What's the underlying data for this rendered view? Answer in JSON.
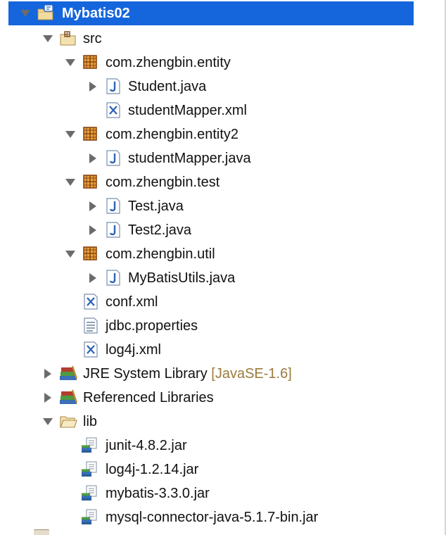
{
  "project_tree": {
    "project": {
      "label": "Mybatis02"
    },
    "src_folder": {
      "label": "src"
    },
    "pkg_entity": {
      "label": "com.zhengbin.entity"
    },
    "file_student_java": {
      "label": "Student.java"
    },
    "file_student_mapper_xml": {
      "label": "studentMapper.xml"
    },
    "pkg_entity2": {
      "label": "com.zhengbin.entity2"
    },
    "file_student_mapper_java": {
      "label": "studentMapper.java"
    },
    "pkg_test": {
      "label": "com.zhengbin.test"
    },
    "file_test_java": {
      "label": "Test.java"
    },
    "file_test2_java": {
      "label": "Test2.java"
    },
    "pkg_util": {
      "label": "com.zhengbin.util"
    },
    "file_mybatis_utils_java": {
      "label": "MyBatisUtils.java"
    },
    "file_conf_xml": {
      "label": "conf.xml"
    },
    "file_jdbc_properties": {
      "label": "jdbc.properties"
    },
    "file_log4j_xml": {
      "label": "log4j.xml"
    },
    "jre_library": {
      "label": "JRE System Library",
      "decoration": "[JavaSE-1.6]"
    },
    "referenced_libraries": {
      "label": "Referenced Libraries"
    },
    "lib_folder": {
      "label": "lib"
    },
    "jar_junit": {
      "label": "junit-4.8.2.jar"
    },
    "jar_log4j": {
      "label": "log4j-1.2.14.jar"
    },
    "jar_mybatis": {
      "label": "mybatis-3.3.0.jar"
    },
    "jar_mysql": {
      "label": "mysql-connector-java-5.1.7-bin.jar"
    }
  },
  "colors": {
    "selection": "#1565dc",
    "decoration_text": "#9a7a3c",
    "package_icon": "#a0522d",
    "java_icon": "#2f63b8"
  }
}
